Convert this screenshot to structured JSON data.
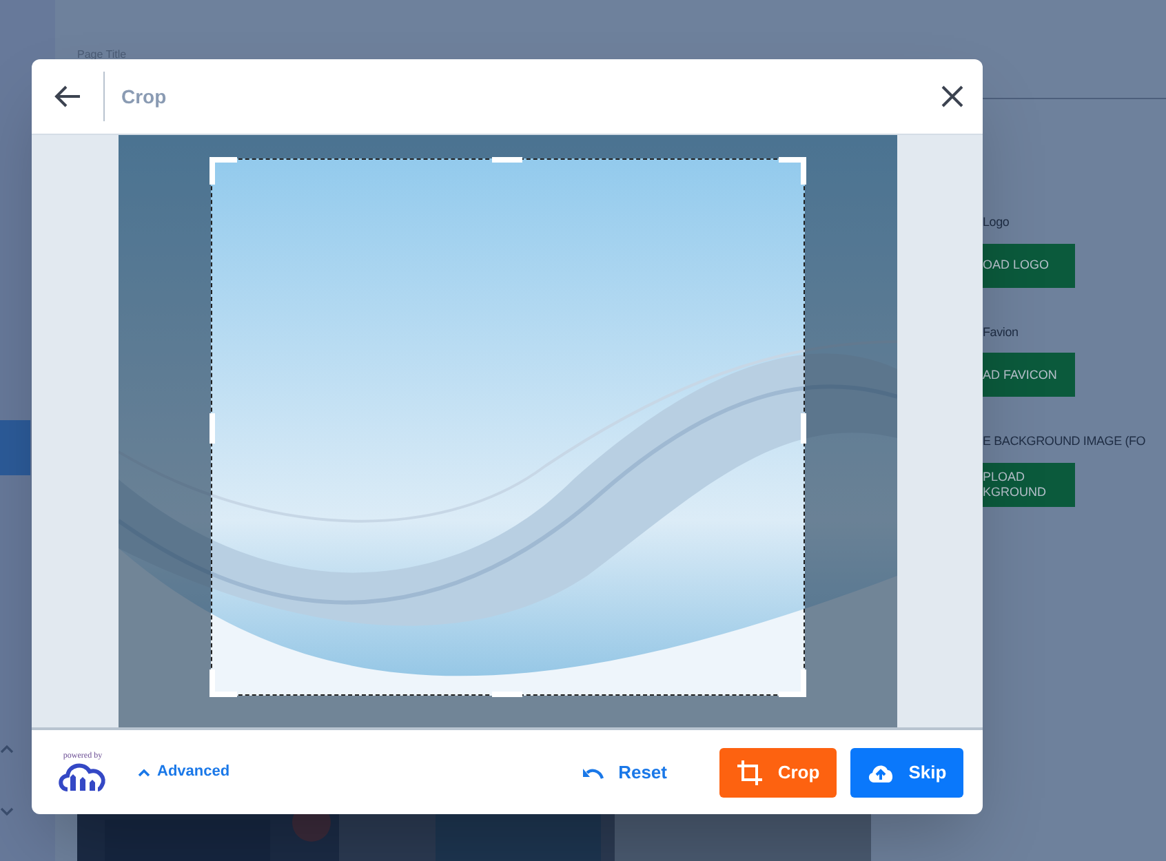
{
  "background_page": {
    "field_label": "Page Title",
    "settings": [
      {
        "label": "Logo",
        "button": "OAD LOGO"
      },
      {
        "label": "Favion",
        "button": "AD FAVICON"
      },
      {
        "label": "E BACKGROUND IMAGE (FO",
        "button": "PLOAD\nKGROUND"
      }
    ]
  },
  "dialog": {
    "title": "Crop",
    "powered_by": "powered by",
    "advanced": {
      "label": "Advanced",
      "expanded": true
    },
    "buttons": [
      {
        "kind": "reset",
        "label": "Reset"
      },
      {
        "kind": "crop",
        "label": "Crop"
      },
      {
        "kind": "skip",
        "label": "Skip"
      }
    ]
  }
}
